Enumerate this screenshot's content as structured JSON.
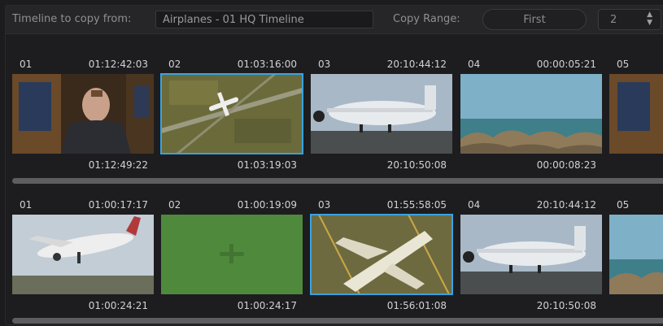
{
  "header": {
    "timeline_label": "Timeline to copy from:",
    "timeline_value": "Airplanes - 01 HQ Timeline",
    "copy_range_label": "Copy Range:",
    "copy_range_value": "First",
    "count_value": "2"
  },
  "strips": [
    {
      "clips": [
        {
          "num": "01",
          "tc_in": "01:12:42:03",
          "tc_out": "01:12:49:22",
          "image": "presenter",
          "selected": false
        },
        {
          "num": "02",
          "tc_in": "01:03:16:00",
          "tc_out": "01:03:19:03",
          "image": "aerial-plane",
          "selected": true
        },
        {
          "num": "03",
          "tc_in": "20:10:44:12",
          "tc_out": "20:10:50:08",
          "image": "airliner-runway",
          "selected": false
        },
        {
          "num": "04",
          "tc_in": "00:00:05:21",
          "tc_out": "00:00:08:23",
          "image": "ocean-reef",
          "selected": false
        },
        {
          "num": "05",
          "tc_in": "",
          "tc_out": "",
          "image": "presenter",
          "selected": false
        }
      ]
    },
    {
      "clips": [
        {
          "num": "01",
          "tc_in": "01:00:17:17",
          "tc_out": "01:00:24:21",
          "image": "takeoff",
          "selected": false
        },
        {
          "num": "02",
          "tc_in": "01:00:19:09",
          "tc_out": "01:00:24:17",
          "image": "green-shadow",
          "selected": false
        },
        {
          "num": "03",
          "tc_in": "01:55:58:05",
          "tc_out": "01:56:01:08",
          "image": "aerial-airliner",
          "selected": true
        },
        {
          "num": "04",
          "tc_in": "20:10:44:12",
          "tc_out": "20:10:50:08",
          "image": "airliner-runway",
          "selected": false
        },
        {
          "num": "05",
          "tc_in": "",
          "tc_out": "",
          "image": "ocean-reef",
          "selected": false
        }
      ]
    }
  ],
  "colors": {
    "selection": "#3aa3e0",
    "panel_bg": "#1d1d20"
  }
}
